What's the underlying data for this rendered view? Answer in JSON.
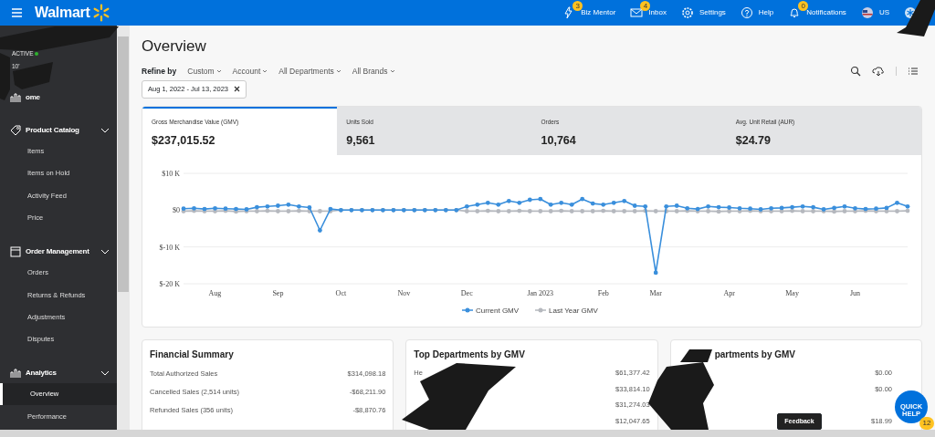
{
  "topbar": {
    "logo": "Walmart",
    "nav": [
      {
        "kind": "bolt",
        "label": "Biz Mentor",
        "badge": "3"
      },
      {
        "kind": "mail",
        "label": "Inbox",
        "badge": "4"
      },
      {
        "kind": "gear",
        "label": "Settings"
      },
      {
        "kind": "help",
        "label": "Help"
      },
      {
        "kind": "bell",
        "label": "Notifications",
        "badge": "0"
      },
      {
        "kind": "flag",
        "label": "US"
      },
      {
        "kind": "avatar"
      }
    ]
  },
  "sidebar": {
    "status": "ACTIVE",
    "online": true,
    "account": "10'",
    "items": [
      {
        "kind": "link",
        "label": "ome"
      },
      {
        "kind": "group",
        "label": "Product Catalog",
        "expanded": true,
        "children": [
          {
            "label": "Items",
            "selected": false
          },
          {
            "label": "Items on Hold",
            "selected": false
          },
          {
            "label": "Activity Feed",
            "selected": false
          },
          {
            "label": "Price",
            "selected": false
          }
        ]
      },
      {
        "kind": "group",
        "label": "Order Management",
        "expanded": true,
        "children": [
          {
            "label": "Orders",
            "selected": false
          },
          {
            "label": "Returns & Refunds",
            "selected": false
          },
          {
            "label": "Adjustments",
            "selected": false
          },
          {
            "label": "Disputes",
            "selected": false
          }
        ]
      },
      {
        "kind": "group",
        "label": "Analytics",
        "expanded": true,
        "children": [
          {
            "label": "Overview",
            "selected": true
          },
          {
            "label": "Performance",
            "selected": false
          }
        ]
      }
    ]
  },
  "page": {
    "title": "Overview",
    "refine_label": "Refine by",
    "filters": [
      "Custom",
      "Account",
      "All Departments",
      "All Brands"
    ],
    "date_chip": "Aug 1, 2022 - Jul 13, 2023"
  },
  "metrics": [
    {
      "label": "Gross Merchandise Value (GMV)",
      "value": "$237,015.52",
      "selected": true
    },
    {
      "label": "Units Sold",
      "value": "9,561",
      "selected": false
    },
    {
      "label": "Orders",
      "value": "10,764",
      "selected": false
    },
    {
      "label": "Avg. Unit Retail (AUR)",
      "value": "$24.79",
      "selected": false
    }
  ],
  "chart_data": {
    "type": "line",
    "categories": [
      null,
      null,
      null,
      "Aug",
      null,
      null,
      null,
      null,
      null,
      "Sep",
      null,
      null,
      null,
      null,
      null,
      "Oct",
      null,
      null,
      null,
      null,
      null,
      "Nov",
      null,
      null,
      null,
      null,
      null,
      "Dec",
      null,
      null,
      null,
      null,
      null,
      null,
      "Jan 2023",
      null,
      null,
      null,
      null,
      null,
      "Feb",
      null,
      null,
      null,
      null,
      "Mar",
      null,
      null,
      null,
      null,
      null,
      null,
      "Apr",
      null,
      null,
      null,
      null,
      null,
      "May",
      null,
      null,
      null,
      null,
      null,
      "Jun",
      null,
      null,
      null,
      null,
      null
    ],
    "series": [
      {
        "name": "Current GMV",
        "color": "#3a8fdc",
        "values": [
          0.4,
          0.5,
          0.3,
          0.5,
          0.4,
          0.3,
          0.2,
          0.8,
          1.0,
          1.2,
          1.5,
          1.0,
          0.7,
          -5.5,
          0.3,
          0,
          0,
          0,
          0,
          0,
          0,
          0,
          0,
          0,
          0,
          0,
          0,
          1.0,
          1.5,
          2.0,
          1.5,
          2.5,
          2.0,
          2.8,
          3.0,
          1.5,
          2.0,
          1.5,
          3.0,
          1.8,
          1.5,
          2.0,
          2.5,
          1.2,
          1.0,
          -17,
          1.0,
          1.2,
          0.5,
          0.3,
          1.0,
          0.8,
          0.7,
          0.5,
          0.4,
          0.2,
          0.5,
          0.6,
          0.8,
          1.0,
          0.8,
          0.2,
          0.6,
          1.0,
          0.5,
          0.3,
          0.4,
          0.6,
          2.0,
          1.0
        ]
      },
      {
        "name": "Last Year GMV",
        "color": "#b5b8be",
        "values": [
          -0.3,
          -0.2,
          -0.3,
          -0.3,
          -0.2,
          -0.4,
          -0.3,
          -0.3,
          -0.2,
          -0.3,
          -0.3,
          -0.2,
          -0.3,
          -0.3,
          -0.3,
          0,
          0,
          0,
          0,
          0,
          0,
          0,
          0,
          0,
          0,
          0,
          0,
          -0.3,
          -0.3,
          -0.2,
          -0.3,
          -0.3,
          -0.2,
          -0.3,
          -0.3,
          -0.3,
          -0.2,
          -0.3,
          -0.3,
          -0.3,
          -0.2,
          -0.3,
          -0.3,
          -0.3,
          -0.2,
          -0.3,
          -0.3,
          -0.3,
          -0.2,
          -0.3,
          -0.3,
          -0.4,
          -0.3,
          -0.3,
          -0.2,
          -0.3,
          -0.3,
          -0.3,
          -0.2,
          -0.3,
          -0.3,
          -0.3,
          -0.4,
          -0.3,
          -0.3,
          -0.2,
          -0.3,
          -0.3,
          -0.3,
          -0.2
        ]
      }
    ],
    "ylim": [
      -20,
      10
    ],
    "legend": "bottom",
    "yticks": [
      {
        "value": 10,
        "label": "$10 K"
      },
      {
        "value": 0,
        "label": "$0"
      },
      {
        "value": -10,
        "label": "$-10 K"
      },
      {
        "value": -20,
        "label": "$-20 K"
      }
    ]
  },
  "cards": [
    {
      "title": "Financial Summary",
      "rows": [
        {
          "label": "Total Authorized Sales",
          "value": "$314,098.18"
        },
        {
          "label": "Cancelled Sales (2,514 units)",
          "value": "-$68,211.90"
        },
        {
          "label": "Refunded Sales (356 units)",
          "value": "-$8,870.76"
        }
      ]
    },
    {
      "title": "Top Departments by GMV",
      "rows": [
        {
          "label": "He",
          "value": "$61,377.42"
        },
        {
          "value": "$33,814.10"
        },
        {
          "value": "$31,274.03"
        },
        {
          "value": "$12,047.65"
        }
      ]
    },
    {
      "title": "partments by GMV",
      "rows": [
        {
          "value": "$0.00"
        },
        {
          "value": "$0.00"
        },
        {},
        {
          "value": "$18.99"
        }
      ]
    }
  ],
  "feedback": "Feedback",
  "quick_help": {
    "label": "QUICK HELP",
    "badge": "12"
  }
}
